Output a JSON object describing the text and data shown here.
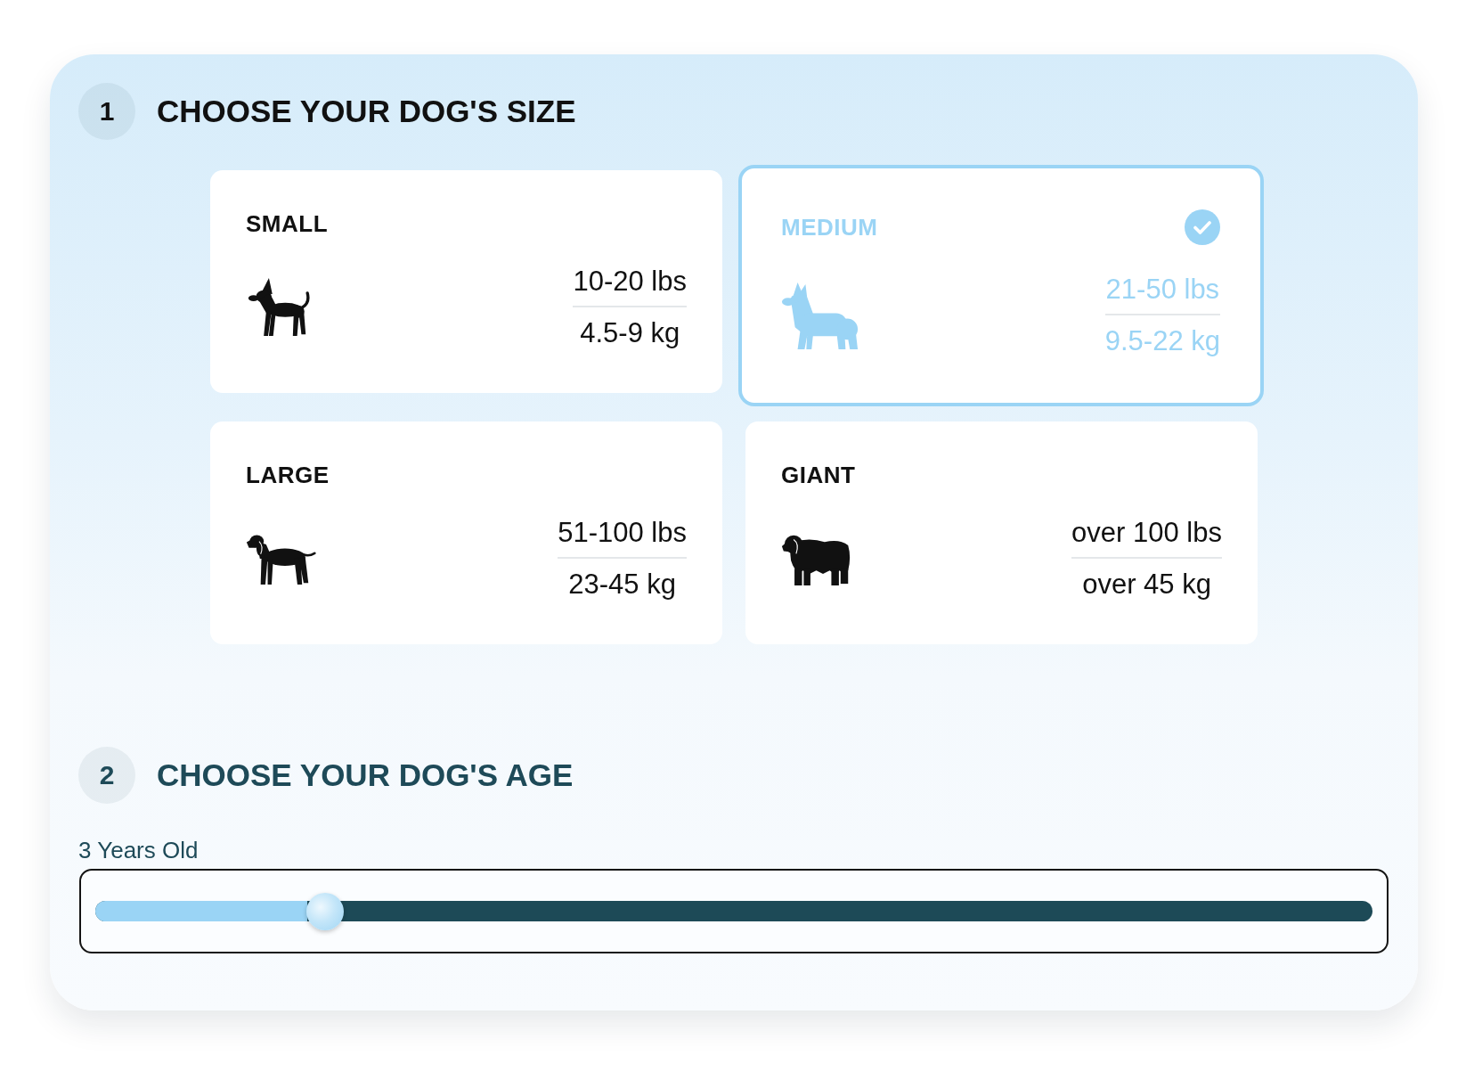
{
  "steps": [
    {
      "kind": "size",
      "number": "1",
      "title": "CHOOSE YOUR DOG'S SIZE",
      "active": true,
      "sizes": [
        {
          "label": "SMALL",
          "weight_lbs": "10-20 lbs",
          "weight_kg": "4.5-9 kg",
          "selected": false
        },
        {
          "label": "MEDIUM",
          "weight_lbs": "21-50 lbs",
          "weight_kg": "9.5-22 kg",
          "selected": true
        },
        {
          "label": "LARGE",
          "weight_lbs": "51-100 lbs",
          "weight_kg": "23-45 kg",
          "selected": false
        },
        {
          "label": "GIANT",
          "weight_lbs": "over 100 lbs",
          "weight_kg": "over 45 kg",
          "selected": false
        }
      ]
    },
    {
      "kind": "age",
      "number": "2",
      "title": "CHOOSE YOUR DOG'S AGE",
      "active": false,
      "age": {
        "reading": "3 Years Old",
        "level": 0.18
      }
    }
  ]
}
